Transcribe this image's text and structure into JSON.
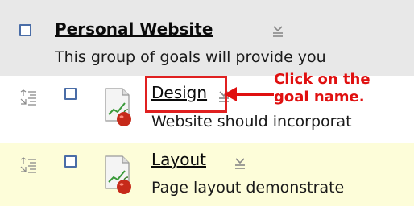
{
  "group": {
    "title": "Personal Website",
    "description": "This group of goals will provide you"
  },
  "goals": [
    {
      "title": "Design",
      "description": "Website should incorporat"
    },
    {
      "title": "Layout",
      "description": "Page layout demonstrate"
    }
  ],
  "annotation": {
    "line1": "Click on the",
    "line2": "goal name."
  },
  "colors": {
    "group_bg": "#e8e8e8",
    "goal2_bg": "#fdfdd9",
    "annotation_red": "#e01010",
    "checkbox_border": "#4a6da7"
  },
  "icons": {
    "menu": "menu-dropdown-icon",
    "reorder": "reorder-icon",
    "goal": "goal-document-apple-icon"
  }
}
